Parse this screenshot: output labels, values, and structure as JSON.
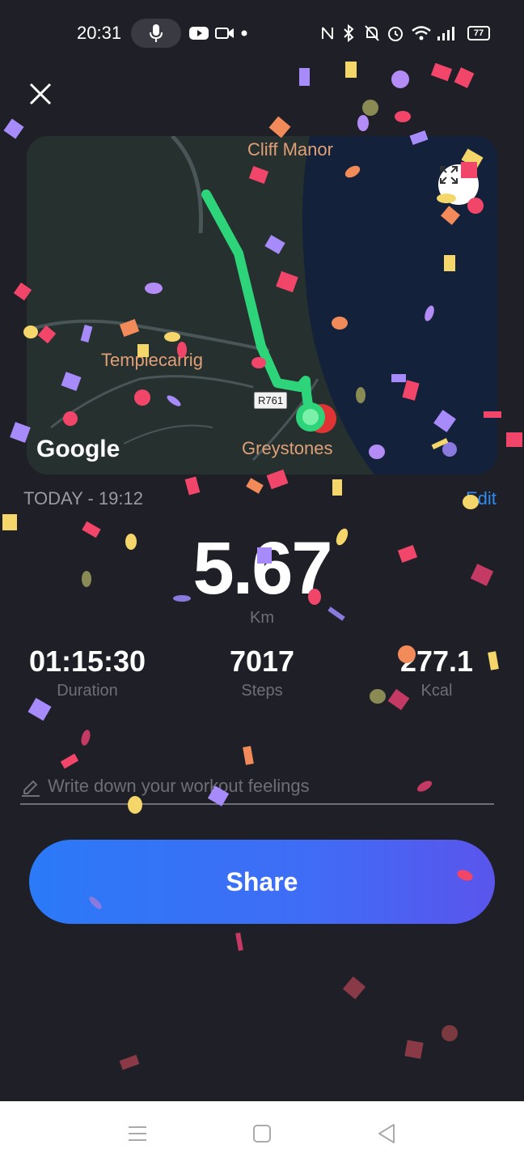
{
  "status_bar": {
    "time": "20:31",
    "icons": [
      "mic-icon",
      "youtube-icon",
      "video-camera-icon",
      "dot-icon",
      "nfc-icon",
      "bluetooth-icon",
      "bell-muted-icon",
      "alarm-icon",
      "wifi-icon",
      "signal-icon"
    ],
    "battery": "77"
  },
  "map": {
    "labels": {
      "north": "Cliff Manor",
      "west": "Templecarrig",
      "south": "Greystones"
    },
    "road_sign": "R761",
    "logo": "Google",
    "route_color": "#2ed47a",
    "sea_color": "#14213a"
  },
  "workout": {
    "date": "TODAY - 19:12",
    "edit_label": "Edit",
    "distance": "5.67",
    "distance_unit": "Km",
    "duration_value": "01:15:30",
    "duration_label": "Duration",
    "steps_value": "7017",
    "steps_label": "Steps",
    "kcal_value": "277.1",
    "kcal_label": "Kcal"
  },
  "notes": {
    "placeholder": "Write down your workout feelings",
    "value": ""
  },
  "share": {
    "label": "Share"
  },
  "colors": {
    "background": "#1f2027",
    "accent_blue": "#2f8cf5",
    "muted_text": "#6e6f76"
  }
}
